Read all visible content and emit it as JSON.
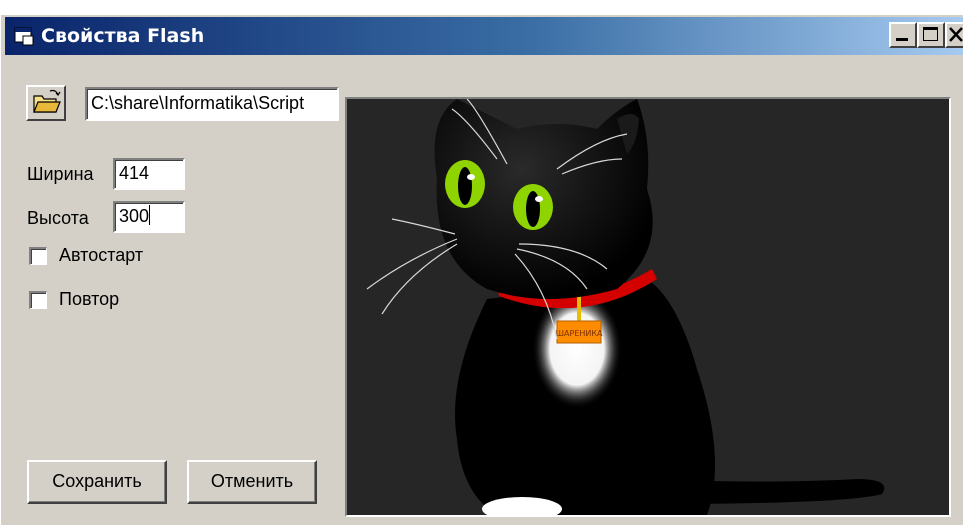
{
  "window": {
    "title": "Свойства Flash",
    "icon": "app-window-icon",
    "controls": [
      "minimize-icon",
      "maximize-icon",
      "close-icon"
    ]
  },
  "form": {
    "file_path": "C:\\share\\Informatika\\Script",
    "width_label": "Ширина",
    "width_value": "414",
    "height_label": "Высота",
    "height_value": "300",
    "autostart_label": "Автостарт",
    "autostart_checked": false,
    "repeat_label": "Повтор",
    "repeat_checked": false,
    "save_label": "Сохранить",
    "cancel_label": "Отменить"
  },
  "preview": {
    "content": "black-cat-flash-animation",
    "tag_text": "ШАРЕНИКА",
    "colors": {
      "background": "#262626",
      "cat": "#000000",
      "eyes": "#8fd400",
      "collar": "#d40000",
      "tag": "#ff8c00"
    }
  }
}
